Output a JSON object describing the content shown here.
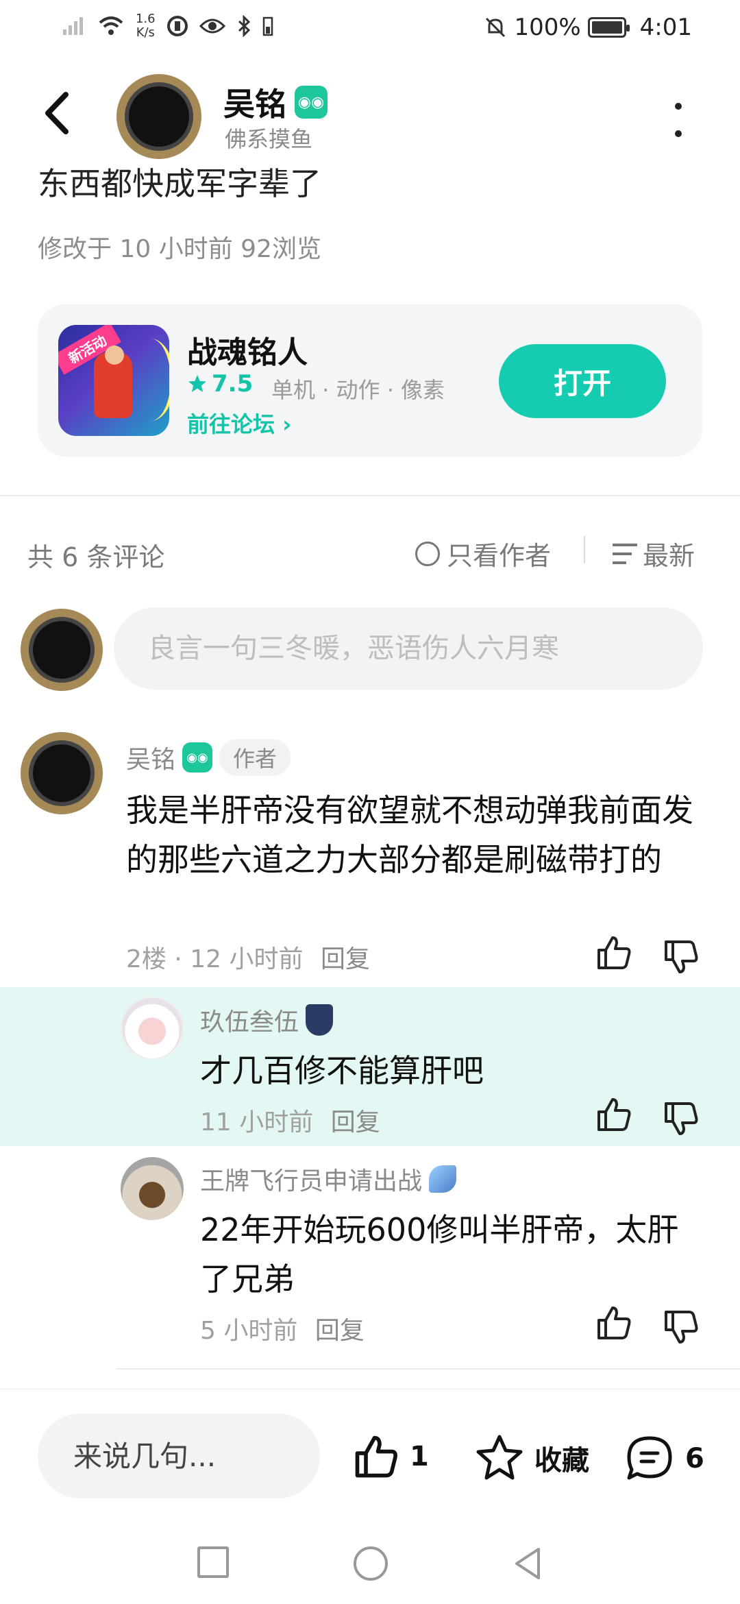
{
  "status_bar": {
    "net_speed_value": "1.6",
    "net_speed_unit": "K/s",
    "battery": "100%",
    "time": "4:01"
  },
  "header": {
    "username": "吴铭",
    "subtitle": "佛系摸鱼"
  },
  "post": {
    "cut_text": "东西都快成军字辈了",
    "meta": "修改于 10 小时前  92浏览"
  },
  "game_card": {
    "icon_tag": "新活动",
    "title": "战魂铭人",
    "rating": "7.5",
    "tags": "单机 · 动作 · 像素",
    "forum_link": "前往论坛",
    "open_button": "打开"
  },
  "comments_header": {
    "count": "共 6 条评论",
    "only_author": "只看作者",
    "sort": "最新"
  },
  "comment_input": {
    "placeholder": "良言一句三冬暖，恶语伤人六月寒"
  },
  "comment": {
    "name": "吴铭",
    "author_tag": "作者",
    "body": "我是半肝帝没有欲望就不想动弹我前面发的那些六道之力大部分都是刷磁带打的",
    "meta": "2楼 · 12 小时前",
    "reply_label": "回复"
  },
  "replies": [
    {
      "name": "玖伍叁伍",
      "body": "才几百修不能算肝吧",
      "time": "11 小时前",
      "reply_label": "回复"
    },
    {
      "name": "王牌飞行员申请出战",
      "body": "22年开始玩600修叫半肝帝，太肝了兄弟",
      "time": "5 小时前",
      "reply_label": "回复"
    }
  ],
  "bottom_bar": {
    "placeholder": "来说几句...",
    "like_count": "1",
    "favorite_label": "收藏",
    "comment_count": "6"
  },
  "colors": {
    "accent": "#15cbb0",
    "highlight_bg": "#e3f8f5",
    "badge_green": "#1ec79b"
  }
}
